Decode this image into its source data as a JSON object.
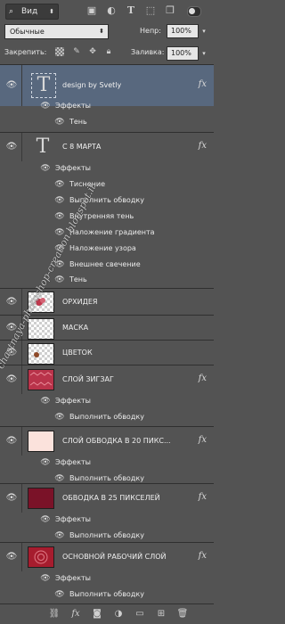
{
  "toolbar": {
    "filter_label": "Вид",
    "icons": [
      "image-filter-icon",
      "adjustment-filter-icon",
      "type-filter-icon",
      "shape-filter-icon",
      "smart-object-filter-icon"
    ]
  },
  "blend": {
    "mode": "Обычные",
    "opacity_label": "Непр:",
    "opacity_value": "100%"
  },
  "lock_row": {
    "lock_label": "Закрепить:",
    "fill_label": "Заливка:",
    "fill_value": "100%"
  },
  "layers": [
    {
      "name": "design by Svetly",
      "kind": "text",
      "selected": true,
      "fx": true,
      "effects_label": "Эффекты",
      "effects": [
        "Тень"
      ]
    },
    {
      "name": "С 8 МАРТА",
      "kind": "text",
      "selected": false,
      "fx": true,
      "effects_label": "Эффекты",
      "effects": [
        "Тиснение",
        "Выполнить обводку",
        "Внутренняя тень",
        "Наложение градиента",
        "Наложение узора",
        "Внешнее свечение",
        "Тень"
      ]
    },
    {
      "name": "ОРХИДЕЯ",
      "kind": "image",
      "fx": false
    },
    {
      "name": "МАСКА",
      "kind": "image",
      "fx": false
    },
    {
      "name": "ЦВЕТОК",
      "kind": "image",
      "fx": false
    },
    {
      "name": "СЛОЙ ЗИГЗАГ",
      "kind": "image",
      "fx": true,
      "effects_label": "Эффекты",
      "effects": [
        "Выполнить обводку"
      ]
    },
    {
      "name": "СЛОЙ ОБВОДКА В 20 ПИКС...",
      "kind": "image",
      "fx": true,
      "effects_label": "Эффекты",
      "effects": [
        "Выполнить обводку"
      ]
    },
    {
      "name": "ОБВОДКА В 25 ПИКСЕЛЕЙ",
      "kind": "image",
      "fx": true,
      "effects_label": "Эффекты",
      "effects": [
        "Выполнить обводку"
      ]
    },
    {
      "name": "ОСНОВНОЙ РАБОЧИЙ СЛОЙ",
      "kind": "image",
      "fx": true,
      "effects_label": "Эффекты",
      "effects": [
        "Выполнить обводку"
      ]
    }
  ],
  "fx_label": "fx",
  "watermark": "chastnaya-photoshop-creation.blogspot.it",
  "colors": {
    "panel": "#535353",
    "selected_row": "#58687e",
    "zigzag_thumb": "#b9334a",
    "stroke20_thumb": "#fbe2dc",
    "stroke25_thumb": "#7a1228",
    "base_thumb": "#a61c2e"
  }
}
